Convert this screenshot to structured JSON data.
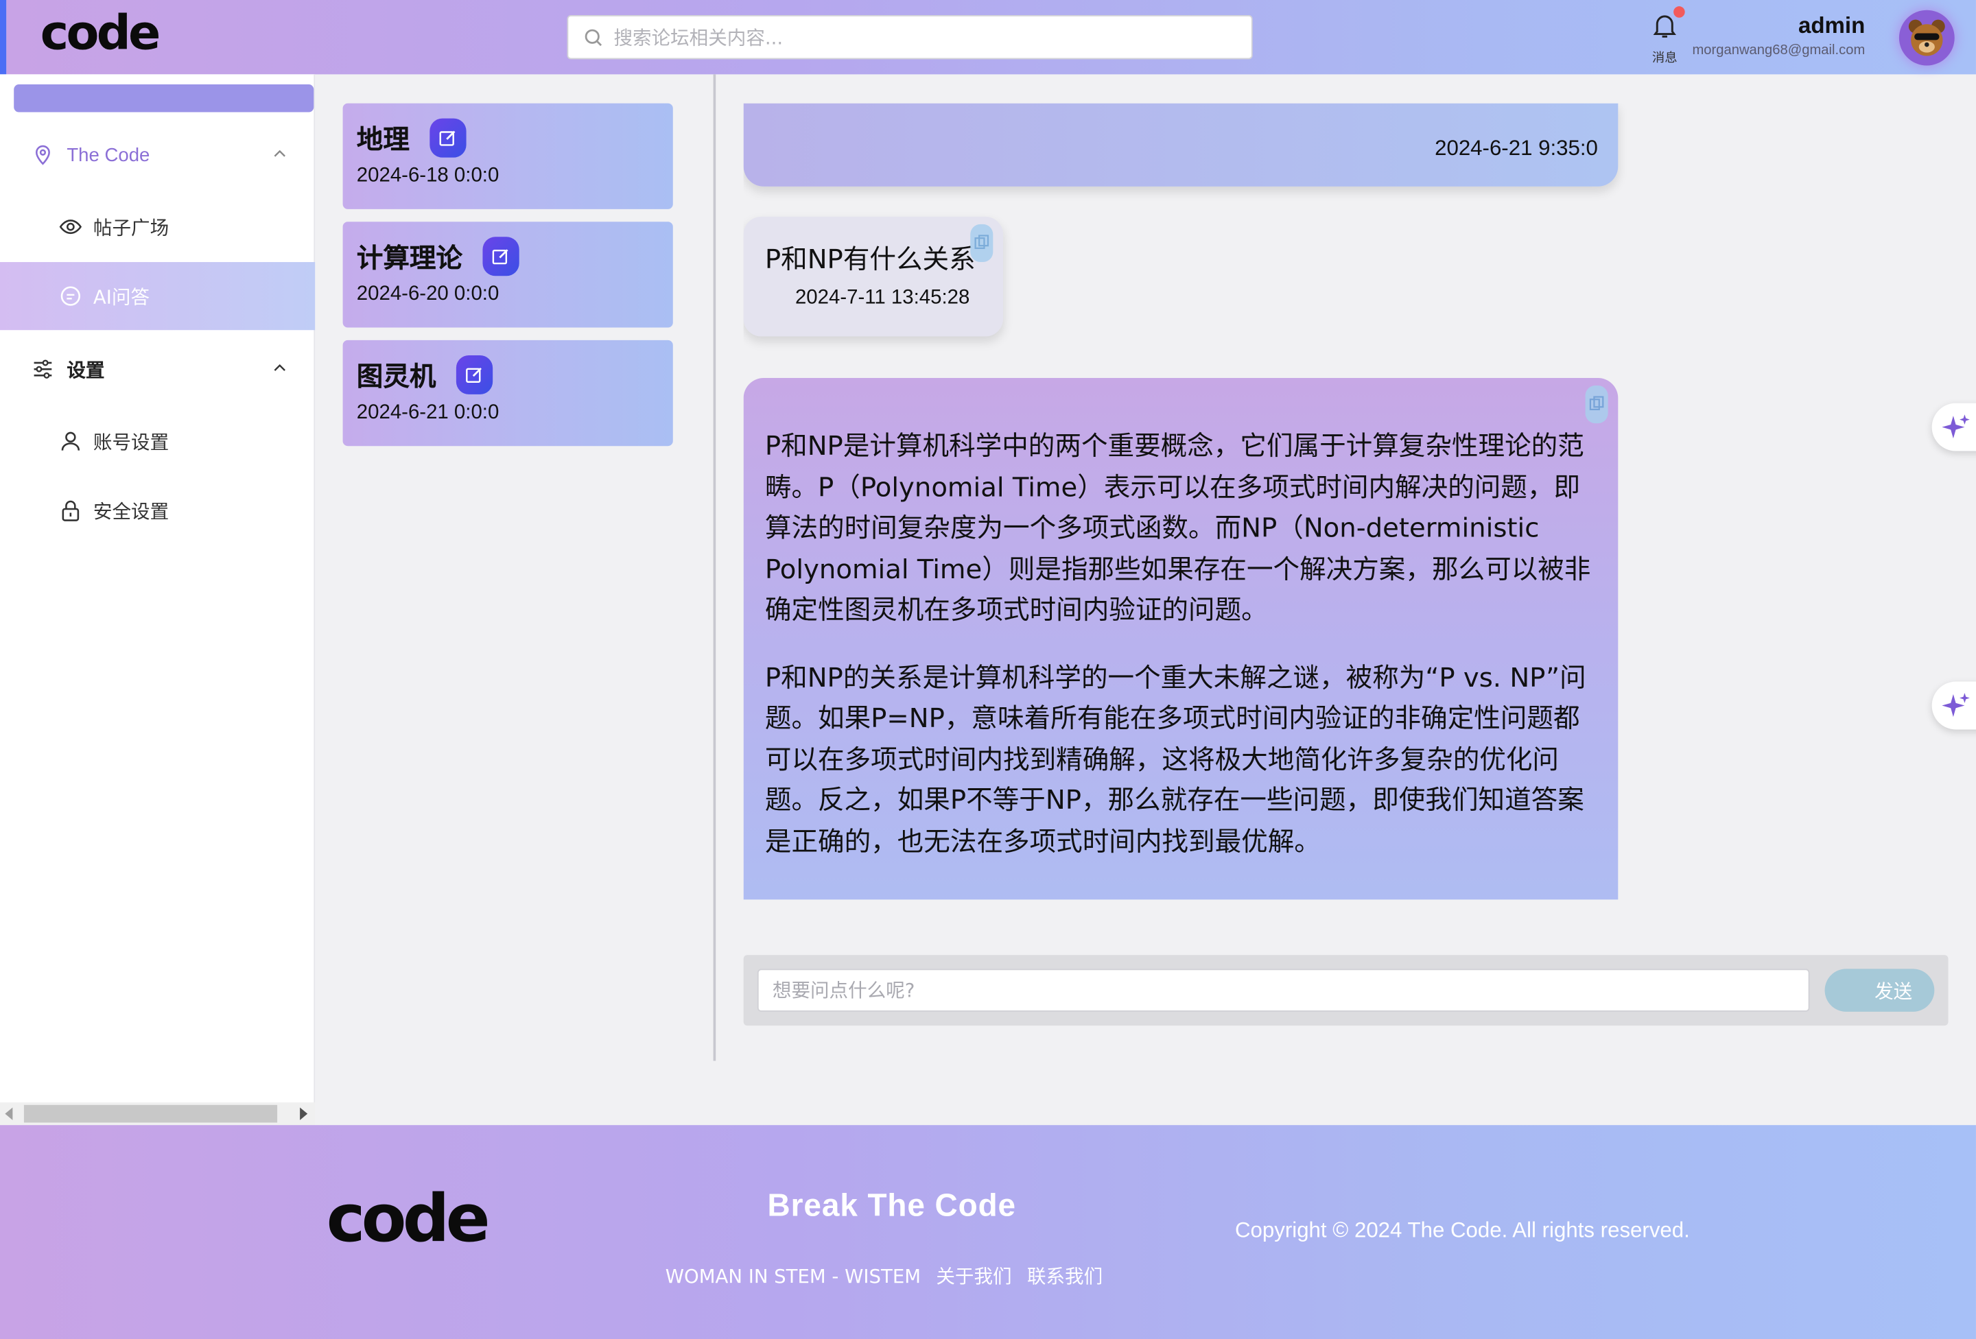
{
  "header": {
    "logo": "code",
    "search_placeholder": "搜索论坛相关内容...",
    "notification_label": "消息",
    "user_name": "admin",
    "user_email": "morganwang68@gmail.com",
    "accent_color": "#4c6ef5"
  },
  "sidebar": {
    "groups": [
      {
        "label": "The Code",
        "icon": "location-pin-icon",
        "expanded": true,
        "items": [
          {
            "label": "帖子广场",
            "icon": "eye-icon",
            "active": false
          },
          {
            "label": "AI问答",
            "icon": "chat-icon",
            "active": true
          }
        ]
      },
      {
        "label": "设置",
        "icon": "sliders-icon",
        "expanded": true,
        "items": [
          {
            "label": "账号设置",
            "icon": "user-icon",
            "active": false
          },
          {
            "label": "安全设置",
            "icon": "lock-icon",
            "active": false
          }
        ]
      }
    ]
  },
  "conversations": [
    {
      "title": "地理",
      "date": "2024-6-18 0:0:0"
    },
    {
      "title": "计算理论",
      "date": "2024-6-20 0:0:0"
    },
    {
      "title": "图灵机",
      "date": "2024-6-21 0:0:0"
    }
  ],
  "chat": {
    "messages": [
      {
        "role": "assistant",
        "time": "2024-6-21 9:35:0"
      },
      {
        "role": "user",
        "text": "P和NP有什么关系",
        "time": "2024-7-11 13:45:28"
      },
      {
        "role": "assistant",
        "paragraphs": [
          "P和NP是计算机科学中的两个重要概念，它们属于计算复杂性理论的范畴。P（Polynomial Time）表示可以在多项式时间内解决的问题，即算法的时间复杂度为一个多项式函数。而NP（Non-deterministic Polynomial Time）则是指那些如果存在一个解决方案，那么可以被非确定性图灵机在多项式时间内验证的问题。",
          "P和NP的关系是计算机科学的一个重大未解之谜，被称为“P vs. NP”问题。如果P=NP，意味着所有能在多项式时间内验证的非确定性问题都可以在多项式时间内找到精确解，这将极大地简化许多复杂的优化问题。反之，如果P不等于NP，那么就存在一些问题，即使我们知道答案是正确的，也无法在多项式时间内找到最优解。"
        ]
      }
    ],
    "input_placeholder": "想要问点什么呢?",
    "send_label": "发送"
  },
  "footer": {
    "logo": "code",
    "slogan": "Break The Code",
    "links": [
      "WOMAN IN STEM - WISTEM",
      "关于我们",
      "联系我们"
    ],
    "copyright": "Copyright © 2024 The Code. All rights reserved."
  }
}
